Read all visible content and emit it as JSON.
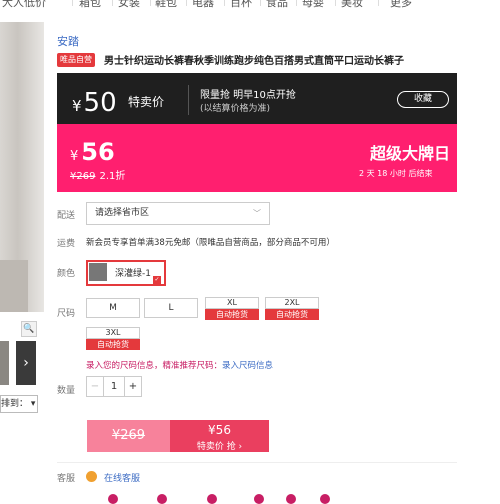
{
  "nav": {
    "items": [
      "大人低价",
      "箱包",
      "女装",
      "鞋包",
      "电器",
      "百杯",
      "食品",
      "母婴",
      "美妆",
      "更多"
    ]
  },
  "product": {
    "brand": "安踏",
    "badge": "唯品自营",
    "title": "男士针织运动长裤春秋季训练跑步纯色百搭男式直筒平口运动长裤子"
  },
  "promo": {
    "price_symbol": "¥",
    "price": "50",
    "tag": "特卖价",
    "line1": "限量抢 明早10点开抢",
    "line2": "(以结算价格为准)",
    "fav_button": "收藏"
  },
  "price": {
    "symbol": "¥",
    "current": "56",
    "original": "¥269",
    "discount": "2.1折",
    "event": "超级大牌日",
    "countdown": "2 天 18 小时 后结束"
  },
  "delivery": {
    "label": "配送",
    "placeholder": "请选择省市区",
    "freight_label": "运费",
    "freight_text": "新会员专享首单满38元免邮（限唯品自营商品，部分商品不可用）"
  },
  "color": {
    "label": "颜色",
    "selected": "深灌绿-1"
  },
  "size": {
    "label": "尺码",
    "options": [
      {
        "name": "M",
        "tag": ""
      },
      {
        "name": "L",
        "tag": ""
      },
      {
        "name": "XL",
        "tag": "自动抢货"
      },
      {
        "name": "2XL",
        "tag": "自动抢货"
      },
      {
        "name": "3XL",
        "tag": "自动抢货"
      }
    ],
    "tip_prefix": "录入您的尺码信息，精准推荐尺码：",
    "tip_link": "录入尺码信息"
  },
  "quantity": {
    "label": "数量",
    "minus": "−",
    "value": "1",
    "plus": "+"
  },
  "buy": {
    "original": "¥269",
    "price": "¥56",
    "sub": "特卖价 抢 ›"
  },
  "service": {
    "label": "客服",
    "link": "在线客服"
  },
  "left": {
    "sort_label": "排到：",
    "sort_arrow": "▾",
    "zoom_icon": "🔍",
    "next_arrow": "›"
  }
}
